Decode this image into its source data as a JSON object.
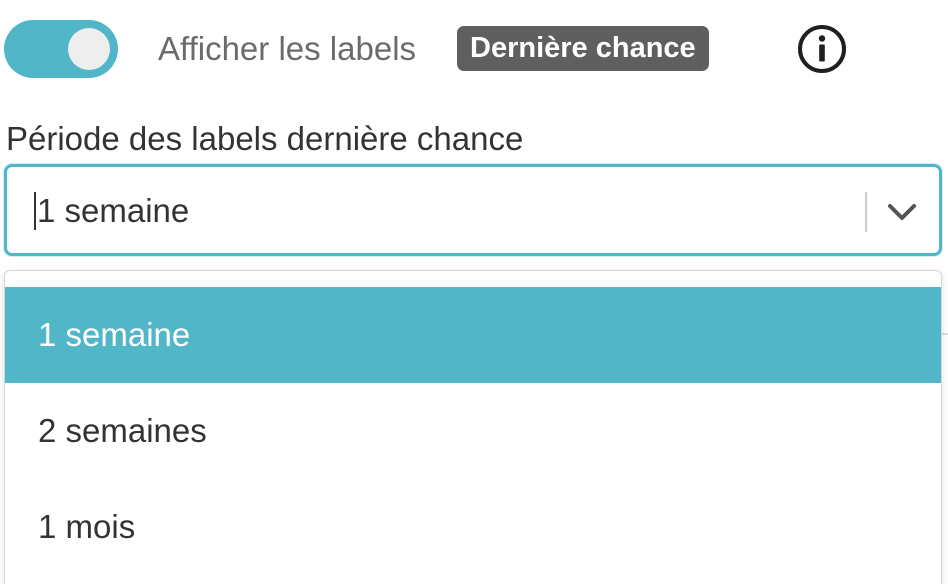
{
  "toggle": {
    "checked": true,
    "label": "Afficher les labels",
    "badge": "Dernière chance"
  },
  "colors": {
    "accent": "#52b6c9",
    "badge_bg": "#5f5f5f",
    "text": "#333333"
  },
  "icons": {
    "info": "info-icon",
    "chevron": "chevron-down-icon"
  },
  "period_select": {
    "label": "Période des labels dernière chance",
    "value": "1 semaine",
    "options": [
      {
        "label": "1 semaine",
        "selected": true
      },
      {
        "label": "2 semaines",
        "selected": false
      },
      {
        "label": "1 mois",
        "selected": false
      }
    ]
  }
}
